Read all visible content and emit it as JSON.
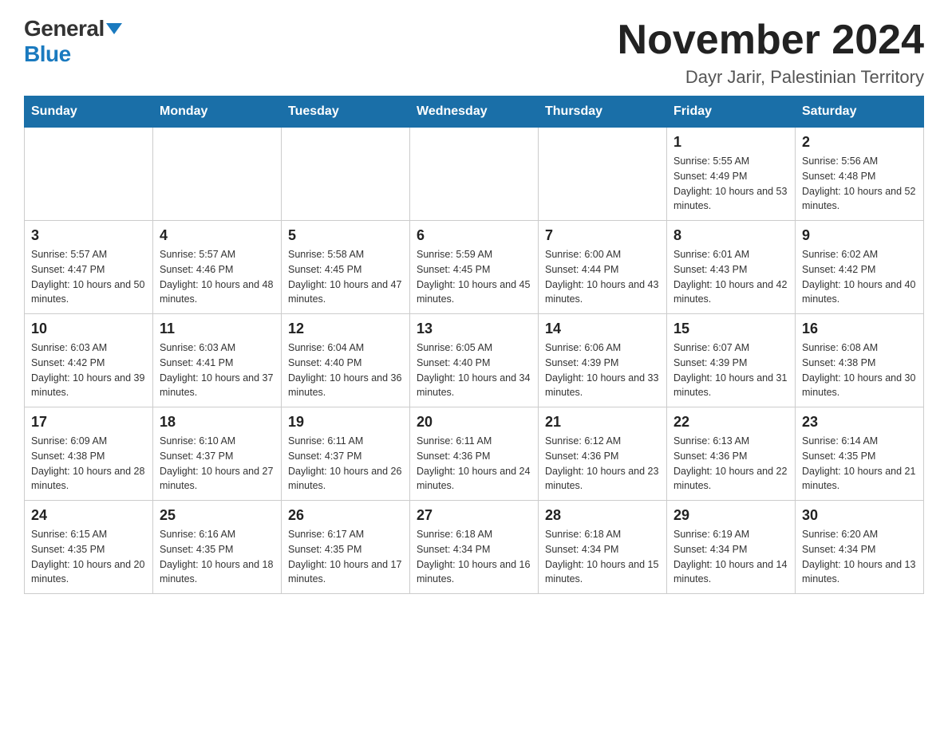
{
  "logo": {
    "general": "General",
    "blue": "Blue"
  },
  "header": {
    "month_year": "November 2024",
    "location": "Dayr Jarir, Palestinian Territory"
  },
  "weekdays": [
    "Sunday",
    "Monday",
    "Tuesday",
    "Wednesday",
    "Thursday",
    "Friday",
    "Saturday"
  ],
  "weeks": [
    [
      {
        "day": "",
        "sunrise": "",
        "sunset": "",
        "daylight": ""
      },
      {
        "day": "",
        "sunrise": "",
        "sunset": "",
        "daylight": ""
      },
      {
        "day": "",
        "sunrise": "",
        "sunset": "",
        "daylight": ""
      },
      {
        "day": "",
        "sunrise": "",
        "sunset": "",
        "daylight": ""
      },
      {
        "day": "",
        "sunrise": "",
        "sunset": "",
        "daylight": ""
      },
      {
        "day": "1",
        "sunrise": "Sunrise: 5:55 AM",
        "sunset": "Sunset: 4:49 PM",
        "daylight": "Daylight: 10 hours and 53 minutes."
      },
      {
        "day": "2",
        "sunrise": "Sunrise: 5:56 AM",
        "sunset": "Sunset: 4:48 PM",
        "daylight": "Daylight: 10 hours and 52 minutes."
      }
    ],
    [
      {
        "day": "3",
        "sunrise": "Sunrise: 5:57 AM",
        "sunset": "Sunset: 4:47 PM",
        "daylight": "Daylight: 10 hours and 50 minutes."
      },
      {
        "day": "4",
        "sunrise": "Sunrise: 5:57 AM",
        "sunset": "Sunset: 4:46 PM",
        "daylight": "Daylight: 10 hours and 48 minutes."
      },
      {
        "day": "5",
        "sunrise": "Sunrise: 5:58 AM",
        "sunset": "Sunset: 4:45 PM",
        "daylight": "Daylight: 10 hours and 47 minutes."
      },
      {
        "day": "6",
        "sunrise": "Sunrise: 5:59 AM",
        "sunset": "Sunset: 4:45 PM",
        "daylight": "Daylight: 10 hours and 45 minutes."
      },
      {
        "day": "7",
        "sunrise": "Sunrise: 6:00 AM",
        "sunset": "Sunset: 4:44 PM",
        "daylight": "Daylight: 10 hours and 43 minutes."
      },
      {
        "day": "8",
        "sunrise": "Sunrise: 6:01 AM",
        "sunset": "Sunset: 4:43 PM",
        "daylight": "Daylight: 10 hours and 42 minutes."
      },
      {
        "day": "9",
        "sunrise": "Sunrise: 6:02 AM",
        "sunset": "Sunset: 4:42 PM",
        "daylight": "Daylight: 10 hours and 40 minutes."
      }
    ],
    [
      {
        "day": "10",
        "sunrise": "Sunrise: 6:03 AM",
        "sunset": "Sunset: 4:42 PM",
        "daylight": "Daylight: 10 hours and 39 minutes."
      },
      {
        "day": "11",
        "sunrise": "Sunrise: 6:03 AM",
        "sunset": "Sunset: 4:41 PM",
        "daylight": "Daylight: 10 hours and 37 minutes."
      },
      {
        "day": "12",
        "sunrise": "Sunrise: 6:04 AM",
        "sunset": "Sunset: 4:40 PM",
        "daylight": "Daylight: 10 hours and 36 minutes."
      },
      {
        "day": "13",
        "sunrise": "Sunrise: 6:05 AM",
        "sunset": "Sunset: 4:40 PM",
        "daylight": "Daylight: 10 hours and 34 minutes."
      },
      {
        "day": "14",
        "sunrise": "Sunrise: 6:06 AM",
        "sunset": "Sunset: 4:39 PM",
        "daylight": "Daylight: 10 hours and 33 minutes."
      },
      {
        "day": "15",
        "sunrise": "Sunrise: 6:07 AM",
        "sunset": "Sunset: 4:39 PM",
        "daylight": "Daylight: 10 hours and 31 minutes."
      },
      {
        "day": "16",
        "sunrise": "Sunrise: 6:08 AM",
        "sunset": "Sunset: 4:38 PM",
        "daylight": "Daylight: 10 hours and 30 minutes."
      }
    ],
    [
      {
        "day": "17",
        "sunrise": "Sunrise: 6:09 AM",
        "sunset": "Sunset: 4:38 PM",
        "daylight": "Daylight: 10 hours and 28 minutes."
      },
      {
        "day": "18",
        "sunrise": "Sunrise: 6:10 AM",
        "sunset": "Sunset: 4:37 PM",
        "daylight": "Daylight: 10 hours and 27 minutes."
      },
      {
        "day": "19",
        "sunrise": "Sunrise: 6:11 AM",
        "sunset": "Sunset: 4:37 PM",
        "daylight": "Daylight: 10 hours and 26 minutes."
      },
      {
        "day": "20",
        "sunrise": "Sunrise: 6:11 AM",
        "sunset": "Sunset: 4:36 PM",
        "daylight": "Daylight: 10 hours and 24 minutes."
      },
      {
        "day": "21",
        "sunrise": "Sunrise: 6:12 AM",
        "sunset": "Sunset: 4:36 PM",
        "daylight": "Daylight: 10 hours and 23 minutes."
      },
      {
        "day": "22",
        "sunrise": "Sunrise: 6:13 AM",
        "sunset": "Sunset: 4:36 PM",
        "daylight": "Daylight: 10 hours and 22 minutes."
      },
      {
        "day": "23",
        "sunrise": "Sunrise: 6:14 AM",
        "sunset": "Sunset: 4:35 PM",
        "daylight": "Daylight: 10 hours and 21 minutes."
      }
    ],
    [
      {
        "day": "24",
        "sunrise": "Sunrise: 6:15 AM",
        "sunset": "Sunset: 4:35 PM",
        "daylight": "Daylight: 10 hours and 20 minutes."
      },
      {
        "day": "25",
        "sunrise": "Sunrise: 6:16 AM",
        "sunset": "Sunset: 4:35 PM",
        "daylight": "Daylight: 10 hours and 18 minutes."
      },
      {
        "day": "26",
        "sunrise": "Sunrise: 6:17 AM",
        "sunset": "Sunset: 4:35 PM",
        "daylight": "Daylight: 10 hours and 17 minutes."
      },
      {
        "day": "27",
        "sunrise": "Sunrise: 6:18 AM",
        "sunset": "Sunset: 4:34 PM",
        "daylight": "Daylight: 10 hours and 16 minutes."
      },
      {
        "day": "28",
        "sunrise": "Sunrise: 6:18 AM",
        "sunset": "Sunset: 4:34 PM",
        "daylight": "Daylight: 10 hours and 15 minutes."
      },
      {
        "day": "29",
        "sunrise": "Sunrise: 6:19 AM",
        "sunset": "Sunset: 4:34 PM",
        "daylight": "Daylight: 10 hours and 14 minutes."
      },
      {
        "day": "30",
        "sunrise": "Sunrise: 6:20 AM",
        "sunset": "Sunset: 4:34 PM",
        "daylight": "Daylight: 10 hours and 13 minutes."
      }
    ]
  ]
}
